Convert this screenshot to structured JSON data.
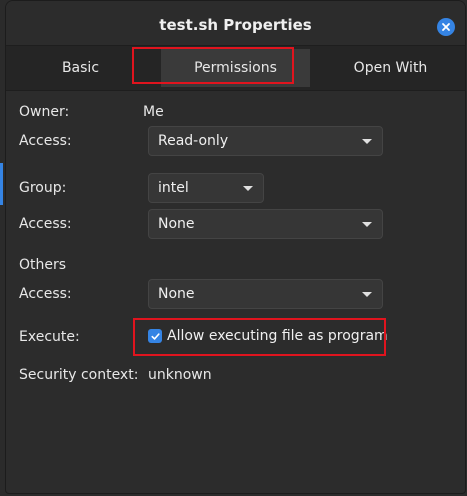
{
  "window": {
    "title": "test.sh Properties"
  },
  "tabs": [
    {
      "label": "Basic"
    },
    {
      "label": "Permissions"
    },
    {
      "label": "Open With"
    }
  ],
  "owner": {
    "label": "Owner:",
    "value": "Me",
    "access_label": "Access:",
    "access_value": "Read-only"
  },
  "group": {
    "label": "Group:",
    "value": "intel",
    "access_label": "Access:",
    "access_value": "None"
  },
  "others": {
    "label": "Others",
    "access_label": "Access:",
    "access_value": "None"
  },
  "execute": {
    "label": "Execute:",
    "checkbox_label": "Allow executing file as program",
    "checked": true
  },
  "security": {
    "label": "Security context:",
    "value": "unknown"
  },
  "colors": {
    "accent": "#3584e4",
    "highlight": "#e0141e"
  },
  "icons": {
    "close": "close-icon",
    "dropdown": "chevron-down-icon",
    "check": "check-icon"
  }
}
